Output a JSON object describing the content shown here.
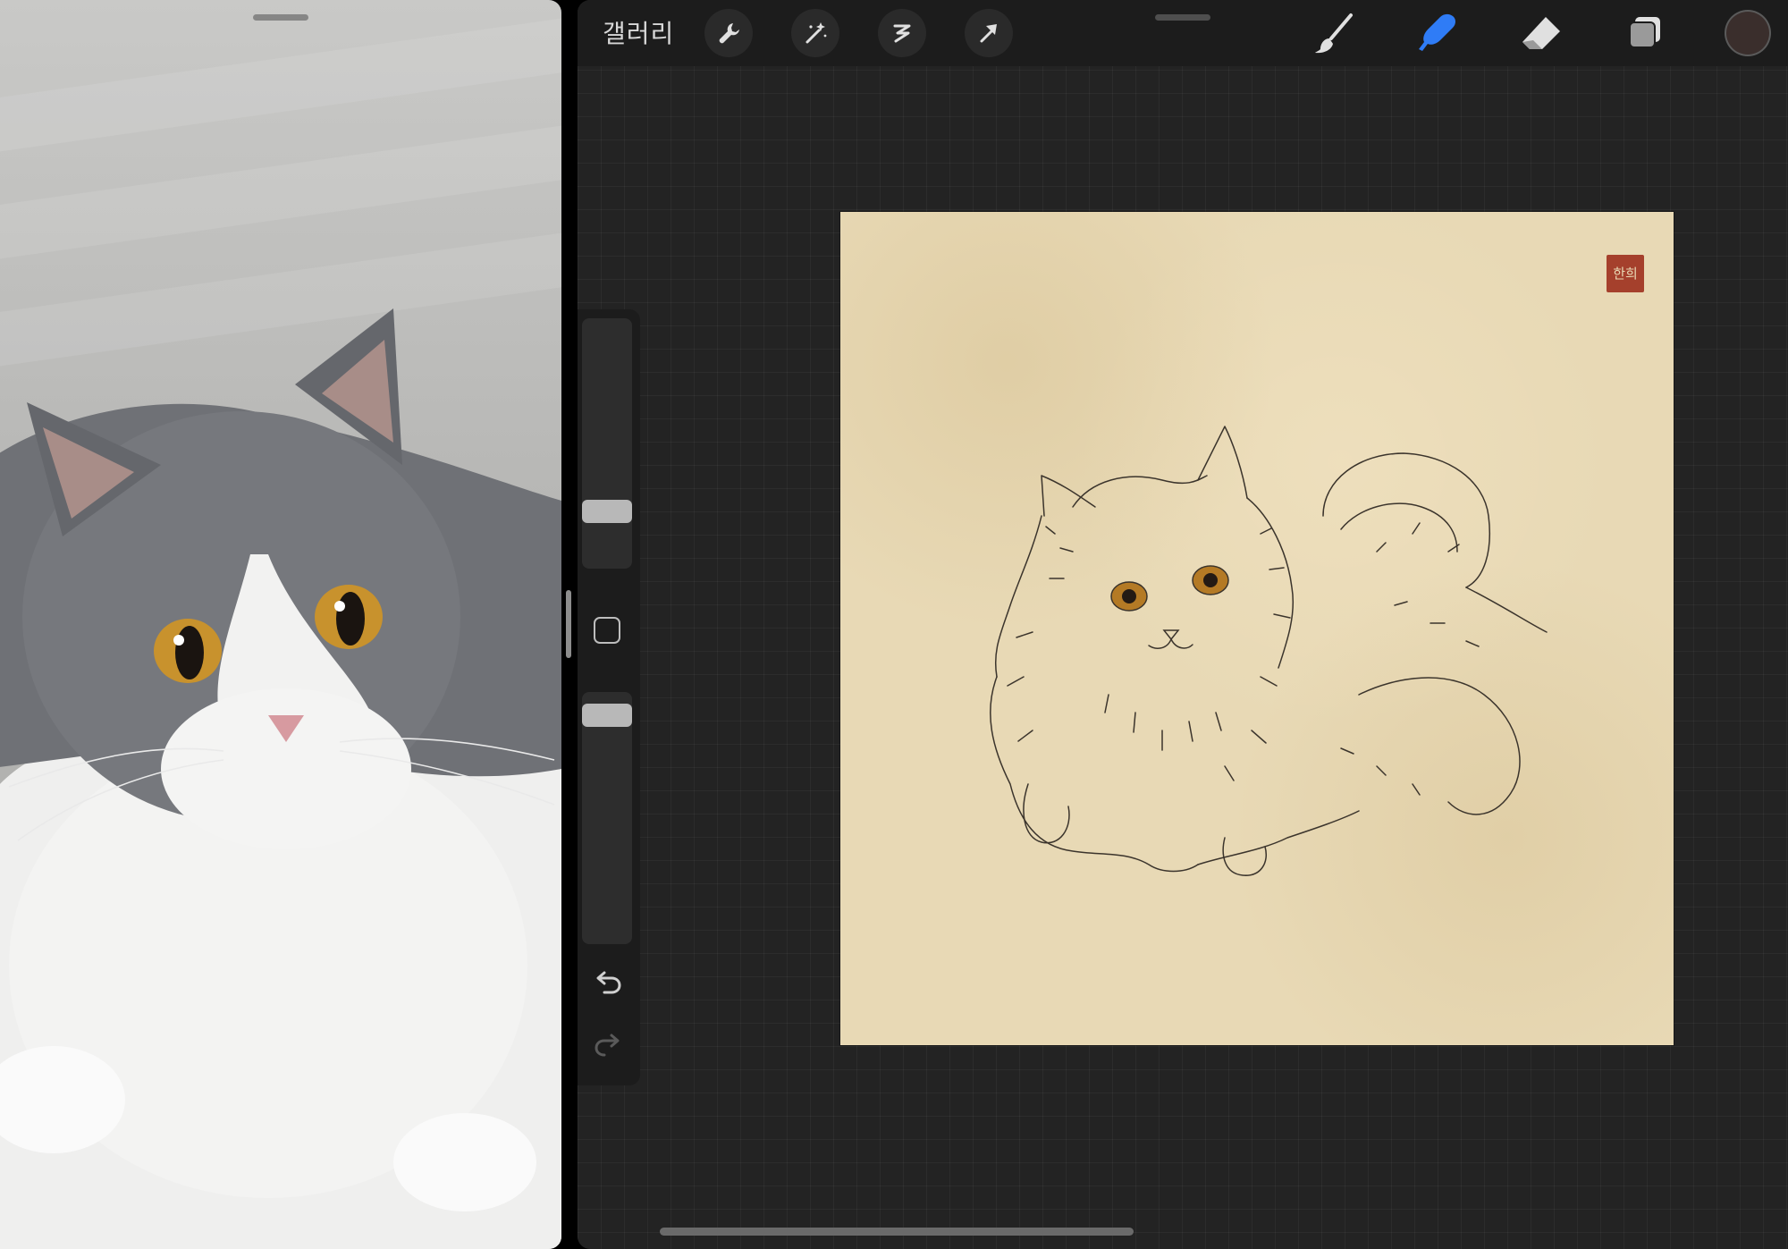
{
  "toolbar": {
    "gallery_label": "갤러리",
    "actions": [
      "wrench-icon",
      "magic-wand-icon",
      "selection-icon",
      "transform-arrow-icon"
    ],
    "tools": [
      "brush-icon",
      "smudge-icon",
      "eraser-icon",
      "layers-icon"
    ],
    "active_tool": "smudge",
    "accent_color": "#2f7cf6",
    "current_color": "#3a2e2c"
  },
  "sidebar": {
    "brush_size": 0.2,
    "opacity": 0.95,
    "icons": [
      "modify-square-icon",
      "undo-icon",
      "redo-icon"
    ]
  },
  "canvas": {
    "paper_color": "#e8d9b5",
    "seal_color": "#a5402c",
    "seal_text": "한희"
  }
}
